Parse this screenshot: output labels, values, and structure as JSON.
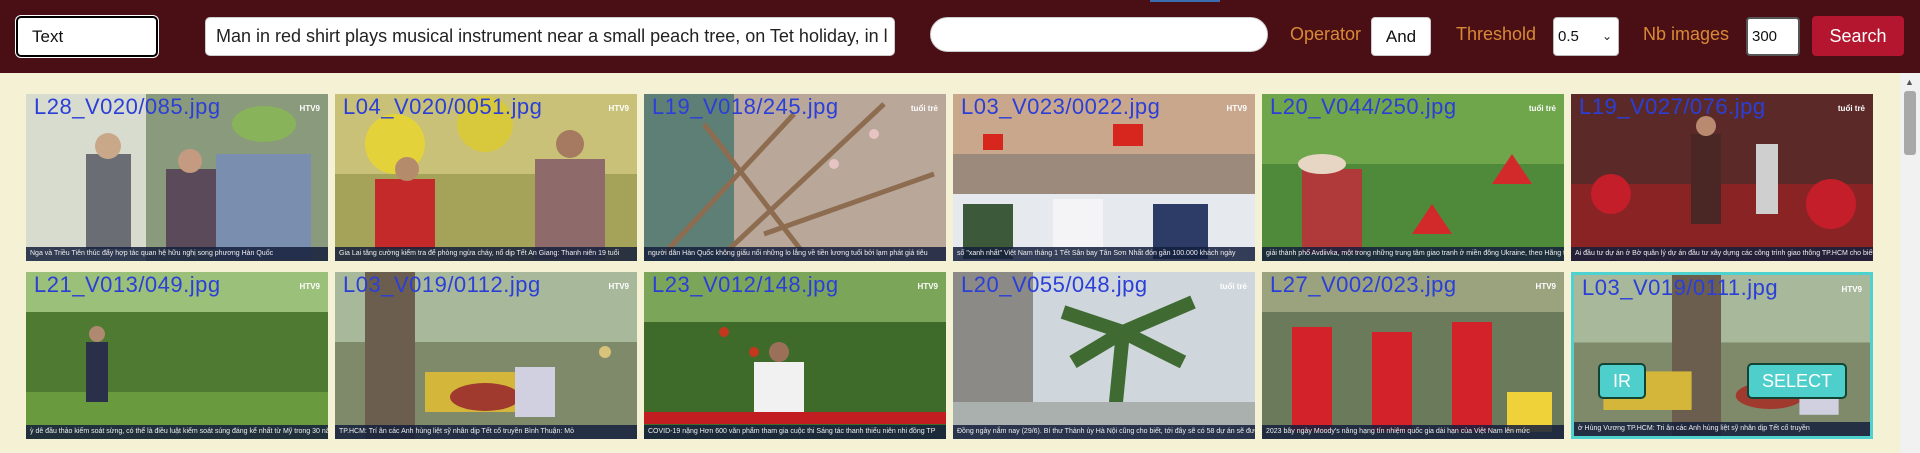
{
  "toolbar": {
    "mode": "Text",
    "query": "Man in red shirt plays musical instrument near a small peach tree, on Tet holiday, in l",
    "second_query": "",
    "operator_label": "Operator",
    "operator_value": "And",
    "threshold_label": "Threshold",
    "threshold_value": "0.5",
    "nb_images_label": "Nb images",
    "nb_images_value": "300",
    "search_label": "Search"
  },
  "results": [
    {
      "name": "L28_V020/085.jpg",
      "logo": "HTV9",
      "ticker": "Nga và Triều Tiên thúc đẩy hợp tác quan hệ hữu nghị song phương   Hàn Quốc"
    },
    {
      "name": "L04_V020/0051.jpg",
      "logo": "HTV9",
      "ticker": "Gia Lai tăng cường kiểm tra để phòng ngừa cháy, nổ dịp Tết   An Giang: Thanh niên 19 tuổi"
    },
    {
      "name": "L19_V018/245.jpg",
      "logo": "tuổi trẻ",
      "ticker": "người dân Hàn Quốc không giấu nổi những lo lắng về tiền lương tuổi bởi lạm phát giá tiêu"
    },
    {
      "name": "L03_V023/0022.jpg",
      "logo": "HTV9",
      "ticker": "số \"xanh nhất\" Việt Nam tháng 1 Tết   Sân bay Tân Sơn Nhất đón gần 100.000 khách ngày"
    },
    {
      "name": "L20_V044/250.jpg",
      "logo": "tuổi trẻ",
      "ticker": "giải thành phố Avdiivka, một trong những trung tâm giao tranh ở miền đông Ukraine, theo Hãng tin Reuters"
    },
    {
      "name": "L19_V027/076.jpg",
      "logo": "tuổi trẻ",
      "ticker": "Ai đầu tư dự án ở Bờ quân lý dự án đầu tư xây dựng các công trình giao thông TP.HCM cho biết với nhiều"
    },
    {
      "name": "L21_V013/049.jpg",
      "logo": "HTV9",
      "ticker": "ỳ dê đầu thảo kiếm soát sừng, có thể là điều luật kiểm soát súng đáng kể nhất từ Mỹ trong 30 năm qua"
    },
    {
      "name": "L03_V019/0112.jpg",
      "logo": "HTV9",
      "ticker": "TP.HCM: Trí ân các Anh hùng liệt sỹ nhân dịp Tết cổ truyền   Bình Thuận: Mỏ"
    },
    {
      "name": "L23_V012/148.jpg",
      "logo": "HTV9",
      "ticker": "COVID-19 nặng   Hơn 600 văn phẩm tham gia cuộc thi Sáng tác thanh thiếu niên nhi đồng TP"
    },
    {
      "name": "L20_V055/048.jpg",
      "logo": "tuổi trẻ",
      "ticker": "Đồng ngày nắm nay (29/6). Bí thư Thành ủy Hà Nội cũng cho biết, tới đây sẽ có 58 dự án sẽ được phép đổi"
    },
    {
      "name": "L27_V002/023.jpg",
      "logo": "HTV9",
      "ticker": "2023 bây ngày   Moody's nâng hạng tín nhiệm quốc gia dài hạn của Việt Nam lên mức"
    },
    {
      "name": "L03_V019/0111.jpg",
      "logo": "HTV9",
      "ticker": "ờ Hùng Vương   TP.HCM: Tri ân các Anh hùng liệt sỹ nhân dịp Tết cổ truyền"
    }
  ],
  "selected_overlay": {
    "ir_label": "IR",
    "select_label": "SELECT"
  },
  "colors": {
    "topbar": "#4a0e15",
    "page": "#f4f1d4",
    "accent_label": "#d98a36",
    "search_button": "#b3162e",
    "filename_text": "#2b3fd8",
    "selection": "#4fd1cf"
  }
}
